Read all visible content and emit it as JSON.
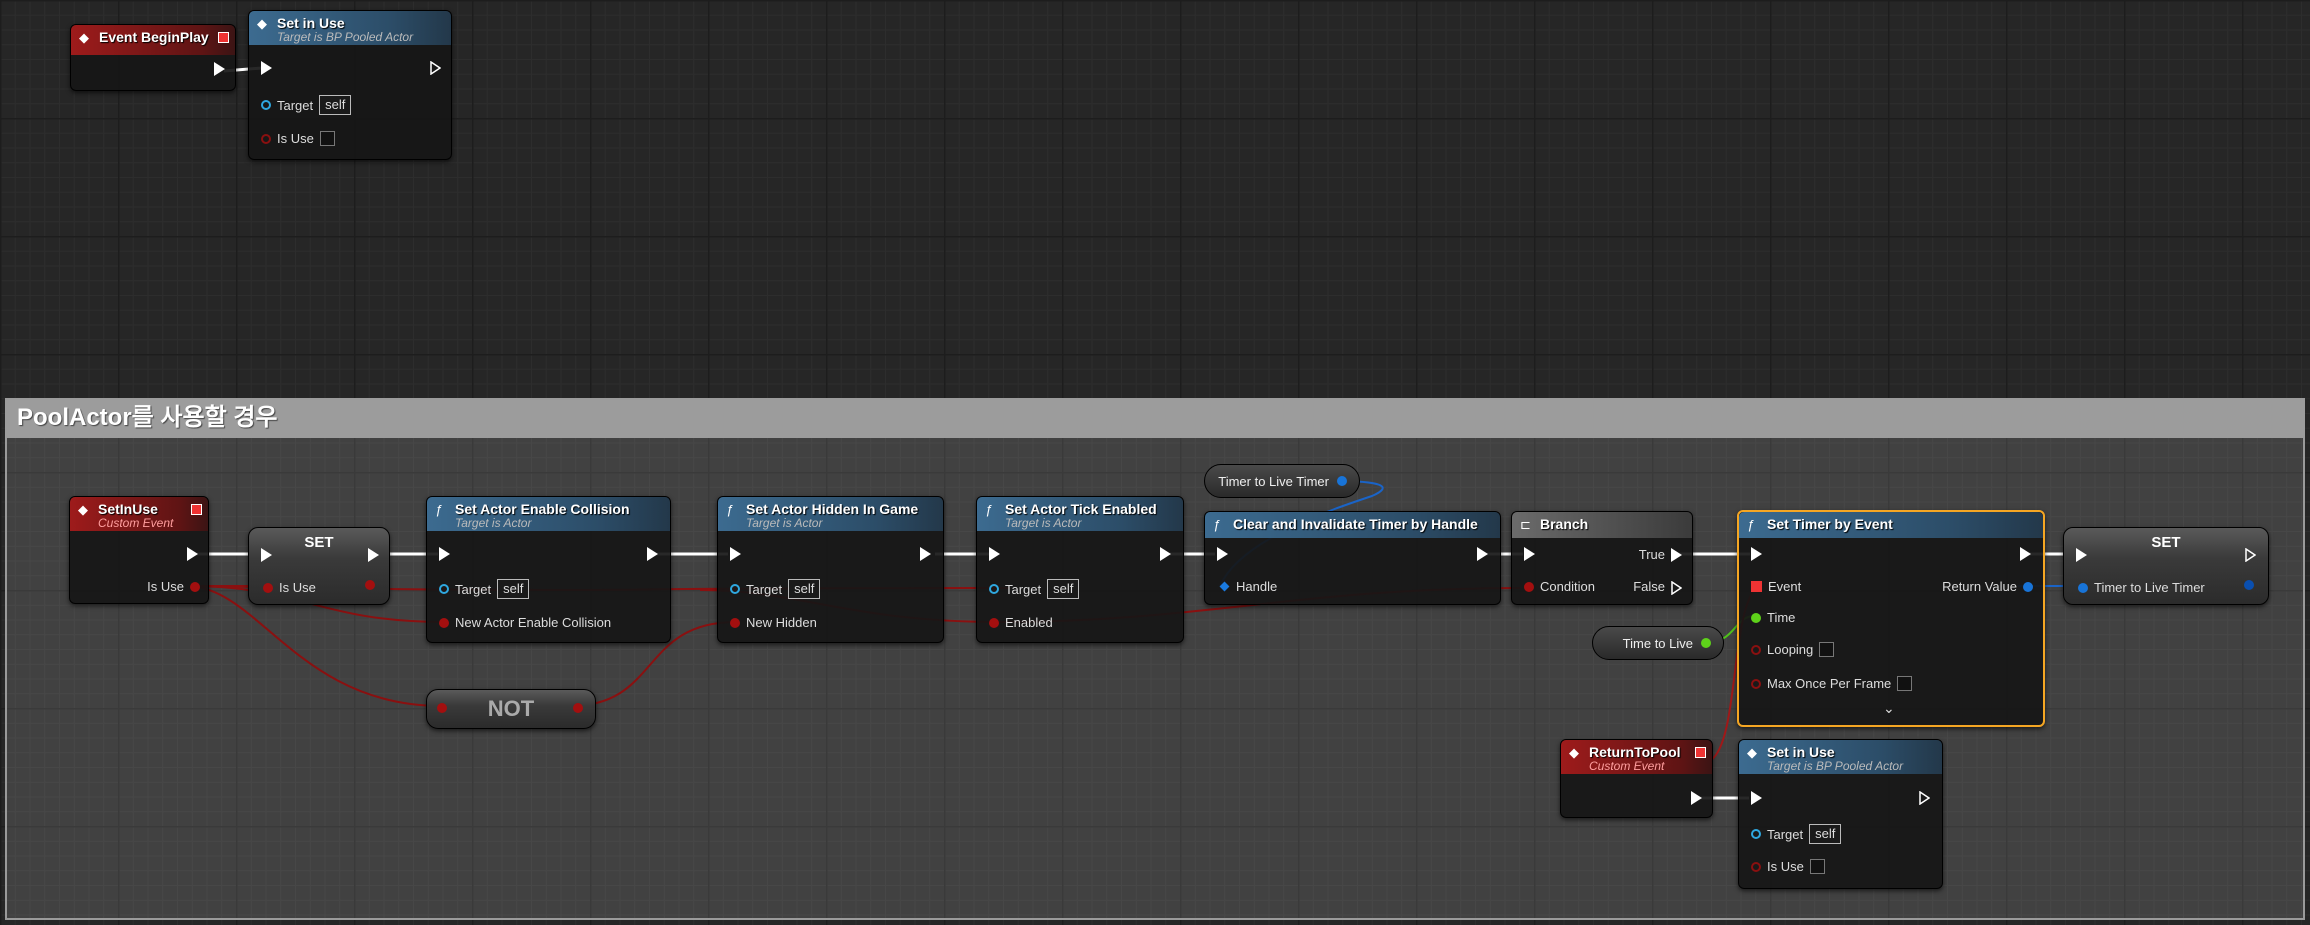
{
  "comment": {
    "title": "PoolActor를 사용할 경우"
  },
  "nodes": {
    "event_beginplay": {
      "title": "Event BeginPlay"
    },
    "set_in_use_top": {
      "title": "Set in Use",
      "subtitle": "Target is BP Pooled Actor",
      "target_label": "Target",
      "target_value": "self",
      "isuse_label": "Is Use"
    },
    "setinuse_event": {
      "title": "SetInUse",
      "subtitle": "Custom Event",
      "out_label": "Is Use"
    },
    "set_var": {
      "title": "SET",
      "in_label": "Is Use"
    },
    "set_collision": {
      "title": "Set Actor Enable Collision",
      "subtitle": "Target is Actor",
      "target_label": "Target",
      "target_value": "self",
      "param_label": "New Actor Enable Collision"
    },
    "not_node": {
      "title": "NOT"
    },
    "set_hidden": {
      "title": "Set Actor Hidden In Game",
      "subtitle": "Target is Actor",
      "target_label": "Target",
      "target_value": "self",
      "param_label": "New Hidden"
    },
    "set_tick": {
      "title": "Set Actor Tick Enabled",
      "subtitle": "Target is Actor",
      "target_label": "Target",
      "target_value": "self",
      "param_label": "Enabled"
    },
    "timer_var": {
      "label": "Timer to Live Timer"
    },
    "clear_timer": {
      "title": "Clear and Invalidate Timer by Handle",
      "param_label": "Handle"
    },
    "branch": {
      "title": "Branch",
      "condition_label": "Condition",
      "true_label": "True",
      "false_label": "False"
    },
    "time_to_live": {
      "label": "Time to Live"
    },
    "set_timer": {
      "title": "Set Timer by Event",
      "event_label": "Event",
      "time_label": "Time",
      "looping_label": "Looping",
      "maxonce_label": "Max Once Per Frame",
      "return_label": "Return Value"
    },
    "set_var2": {
      "title": "SET",
      "in_label": "Timer to Live Timer"
    },
    "return_event": {
      "title": "ReturnToPool",
      "subtitle": "Custom Event"
    },
    "set_in_use_bottom": {
      "title": "Set in Use",
      "subtitle": "Target is BP Pooled Actor",
      "target_label": "Target",
      "target_value": "self",
      "isuse_label": "Is Use"
    }
  },
  "colors": {
    "selected_outline": "#f5a623",
    "exec_wire": "#ffffff",
    "bool_wire": "#8a0f0f",
    "struct_wire": "#1a64c8"
  }
}
